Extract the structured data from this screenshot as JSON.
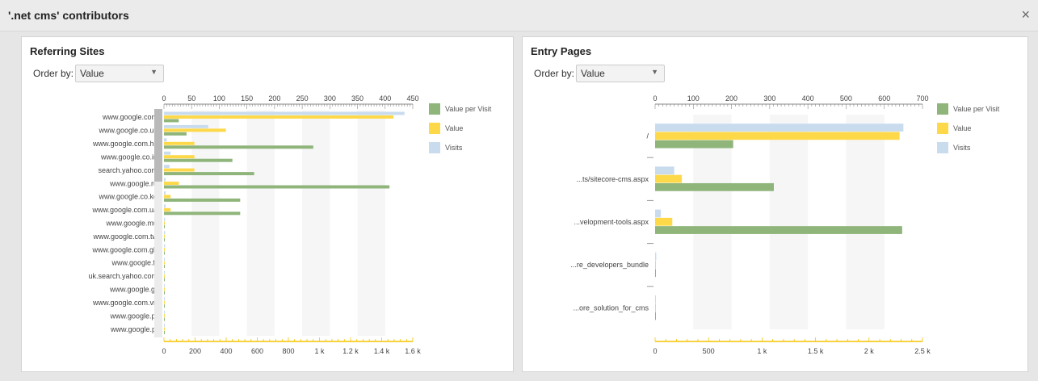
{
  "dialog": {
    "title": "'.net cms' contributors",
    "close_symbol": "×"
  },
  "left": {
    "title": "Referring Sites",
    "order_label": "Order by:",
    "order_value": "Value",
    "legend": [
      {
        "name": "Value per Visit",
        "color": "#8fb57b"
      },
      {
        "name": "Value",
        "color": "#fdd94a"
      },
      {
        "name": "Visits",
        "color": "#c9dcee"
      }
    ],
    "chart_data": {
      "type": "bar",
      "orientation": "horizontal",
      "categories": [
        "www.google.com",
        "www.google.co.uk",
        "www.google.com.hk",
        "www.google.co.in",
        "search.yahoo.com",
        "www.google.ru",
        "www.google.co.ke",
        "www.google.com.ua",
        "www.google.mu",
        "www.google.com.tw",
        "www.google.com.gh",
        "www.google.fr",
        "uk.search.yahoo.com",
        "www.google.gr",
        "www.google.com.vn",
        "www.google.pt",
        "www.google.pl"
      ],
      "series": [
        {
          "name": "Visits",
          "axis": "top",
          "values": [
            435,
            80,
            5,
            12,
            10,
            3,
            3,
            3,
            2,
            2,
            2,
            1,
            1,
            1,
            1,
            1,
            1
          ]
        },
        {
          "name": "Value",
          "axis": "top",
          "values": [
            415,
            112,
            55,
            55,
            55,
            27,
            12,
            12,
            0,
            0,
            0,
            0,
            0,
            0,
            0,
            0,
            0
          ]
        },
        {
          "name": "Value per Visit",
          "axis": "bottom",
          "values": [
            95,
            145,
            960,
            440,
            580,
            1450,
            490,
            490,
            0,
            0,
            0,
            0,
            0,
            0,
            0,
            0,
            0
          ]
        }
      ],
      "top_axis": {
        "min": 0,
        "max": 450,
        "ticks": [
          "0",
          "50",
          "100",
          "150",
          "200",
          "250",
          "300",
          "350",
          "400",
          "450"
        ]
      },
      "bottom_axis": {
        "min": 0,
        "max": 1600,
        "ticks": [
          "0",
          "200",
          "400",
          "600",
          "800",
          "1 k",
          "1.2 k",
          "1.4 k",
          "1.6 k"
        ]
      },
      "grid": true,
      "legend_position": "right"
    }
  },
  "right": {
    "title": "Entry Pages",
    "order_label": "Order by:",
    "order_value": "Value",
    "legend": [
      {
        "name": "Value per Visit",
        "color": "#8fb57b"
      },
      {
        "name": "Value",
        "color": "#fdd94a"
      },
      {
        "name": "Visits",
        "color": "#c9dcee"
      }
    ],
    "chart_data": {
      "type": "bar",
      "orientation": "horizontal",
      "categories": [
        "/",
        "...ts/sitecore-cms.aspx",
        "...velopment-tools.aspx",
        "...re_developers_bundle",
        "...ore_solution_for_cms"
      ],
      "series": [
        {
          "name": "Visits",
          "axis": "top",
          "values": [
            650,
            50,
            15,
            3,
            2
          ]
        },
        {
          "name": "Value",
          "axis": "top",
          "values": [
            640,
            70,
            45,
            0,
            0
          ]
        },
        {
          "name": "Value per Visit",
          "axis": "bottom",
          "values": [
            730,
            1110,
            2310,
            0,
            0
          ]
        }
      ],
      "top_axis": {
        "min": 0,
        "max": 700,
        "ticks": [
          "0",
          "100",
          "200",
          "300",
          "400",
          "500",
          "600",
          "700"
        ]
      },
      "bottom_axis": {
        "min": 0,
        "max": 2500,
        "ticks": [
          "0",
          "500",
          "1 k",
          "1.5 k",
          "2 k",
          "2.5 k"
        ]
      },
      "grid": true,
      "legend_position": "right"
    }
  }
}
